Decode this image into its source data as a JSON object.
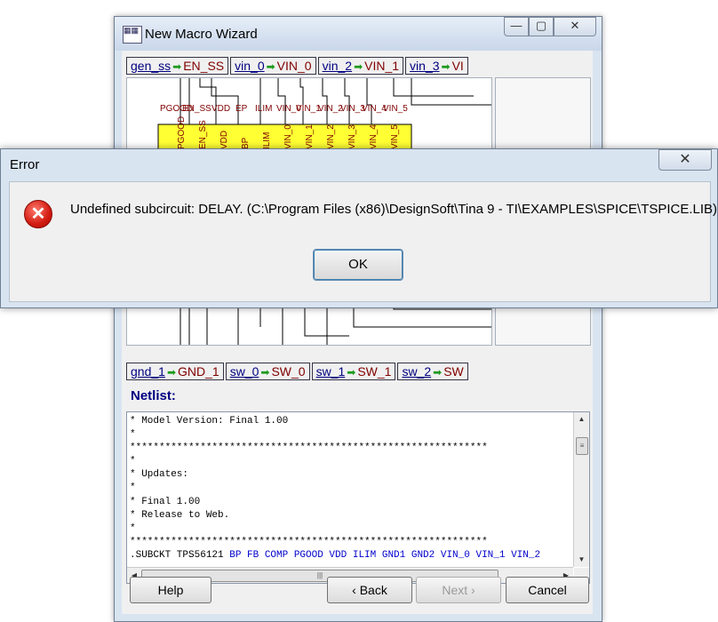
{
  "wizard": {
    "title": "New Macro Wizard",
    "caption_buttons": {
      "minimize": "—",
      "maximize": "▢",
      "close": "✕"
    },
    "top_pins": [
      {
        "net": "gen_ss",
        "port": "EN_SS"
      },
      {
        "net": "vin_0",
        "port": "VIN_0"
      },
      {
        "net": "vin_2",
        "port": "VIN_1"
      },
      {
        "net": "vin_3",
        "port": "VI"
      }
    ],
    "bottom_pins": [
      {
        "net": "gnd_1",
        "port": "GND_1"
      },
      {
        "net": "sw_0",
        "port": "SW_0"
      },
      {
        "net": "sw_1",
        "port": "SW_1"
      },
      {
        "net": "sw_2",
        "port": "SW"
      }
    ],
    "schematic": {
      "pin_labels_top": [
        "PGOOD",
        "EN_SS",
        "VDD",
        "EP",
        "ILIM",
        "VIN_0",
        "VIN_1",
        "VIN_2",
        "VIN_3",
        "VIN_4",
        "VIN_5"
      ],
      "pin_labels_chip": [
        "PGOOD",
        "EN_SS",
        "VDD",
        "BP",
        "ILIM",
        "VIN_0",
        "VIN_1",
        "VIN_2",
        "VIN_3",
        "VIN_4",
        "VIN_5"
      ]
    },
    "netlist_label": "Netlist:",
    "netlist_lines": [
      "* Model Version: Final 1.00",
      "*",
      "*************************************************************",
      "*",
      "* Updates:",
      "*",
      "* Final 1.00",
      "* Release to Web.",
      "*",
      "*************************************************************"
    ],
    "netlist_subckt_prefix": ".SUBCKT TPS56121 ",
    "netlist_subckt_pins": "BP FB COMP PGOOD VDD ILIM GND1 GND2 VIN_0 VIN_1 VIN_2",
    "buttons": {
      "help": "Help",
      "back": "‹ Back",
      "next": "Next ›",
      "cancel": "Cancel"
    }
  },
  "error_dialog": {
    "title": "Error",
    "close_glyph": "✕",
    "icon_glyph": "✕",
    "message": "Undefined subcircuit: DELAY. (C:\\Program Files (x86)\\DesignSoft\\Tina 9 - TI\\EXAMPLES\\SPICE\\TSPICE.LIB)",
    "ok_label": "OK"
  }
}
